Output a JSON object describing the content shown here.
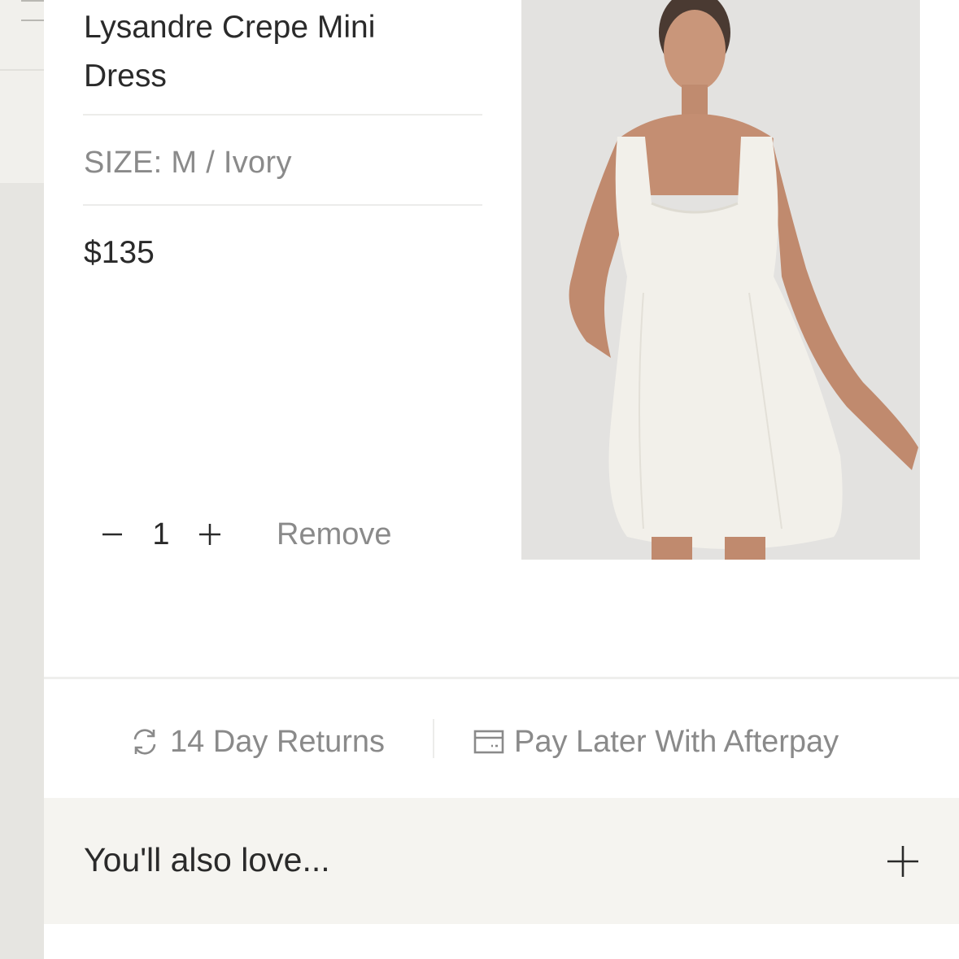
{
  "cart_item": {
    "title": "Lysandre Crepe Mini Dress",
    "size_line": "SIZE: M / Ivory",
    "price": "$135",
    "quantity": "1",
    "remove_label": "Remove",
    "image_alt": "Model wearing ivory square-neck mini dress"
  },
  "perks": {
    "returns": "14 Day Returns",
    "returns_icon": "refresh-icon",
    "afterpay": "Pay Later With Afterpay",
    "afterpay_icon": "credit-card-icon"
  },
  "recommendations": {
    "label": "You'll also love...",
    "toggle_icon": "plus-icon"
  },
  "colors": {
    "text_primary": "#2a2a2a",
    "text_muted": "#8a8a8a",
    "accordion_bg": "#f5f4f0",
    "image_bg": "#e2e1df",
    "dress": "#f2f0ea"
  }
}
